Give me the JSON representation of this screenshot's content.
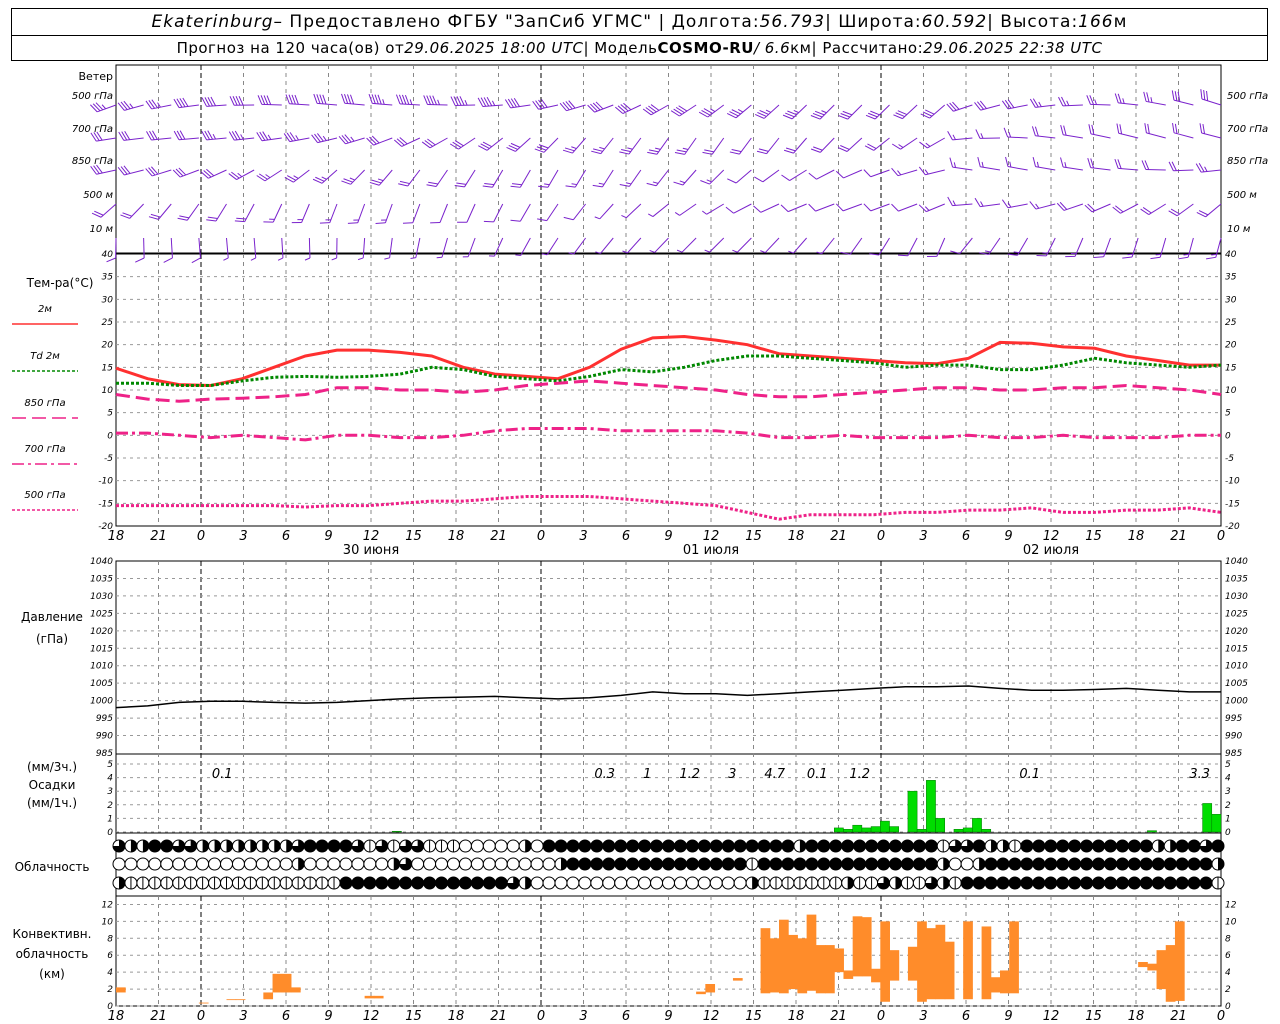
{
  "header": {
    "line1": {
      "station": "Ekaterinburg",
      "provider": " – Предоставлено ФГБУ \"ЗапСиб УГМС\" | Долгота: ",
      "lon": "56.793",
      "lat_label": " | Широта: ",
      "lat": "60.592",
      "alt_label": " | Высота: ",
      "alt": "166",
      "alt_unit": "м"
    },
    "line2": {
      "forecast_label": "Прогноз на 120 часа(ов) от ",
      "forecast_start": "29.06.2025 18:00 UTC",
      "model_label": "  | Модель ",
      "model": "COSMO-RU",
      "resolution": " / 6.6",
      "resolution_unit": "км",
      "calc_label": " | Рассчитано: ",
      "calc_time": "29.06.2025 22:38 UTC"
    }
  },
  "chart_data": {
    "time_axis": {
      "tick_labels": [
        "18",
        "21",
        "0",
        "3",
        "6",
        "9",
        "12",
        "15",
        "18",
        "21",
        "0",
        "3",
        "6",
        "9",
        "12",
        "15",
        "18",
        "21",
        "0",
        "3",
        "6",
        "9",
        "12",
        "15",
        "18",
        "21",
        "0"
      ],
      "day_labels": [
        {
          "label": "30 июня",
          "tick": 6
        },
        {
          "label": "01 июля",
          "tick": 14
        },
        {
          "label": "02 июля",
          "tick": 22
        }
      ]
    },
    "wind": {
      "title": "Ветер",
      "levels": [
        "500 гПа",
        "700 гПа",
        "850 гПа",
        "500 м",
        "10 м"
      ],
      "color": "#7a22cc"
    },
    "temperature": {
      "type": "line",
      "title": "Тем-ра(°C)",
      "ylim": [
        -20,
        40
      ],
      "yticks": [
        -20,
        -15,
        -10,
        -5,
        0,
        5,
        10,
        15,
        20,
        25,
        30,
        35,
        40
      ],
      "series": [
        {
          "name": "2м",
          "color": "#ff3030",
          "style": "solid",
          "values": [
            14.8,
            12.5,
            11.2,
            11.0,
            12.5,
            15.0,
            17.5,
            18.8,
            18.8,
            18.3,
            17.5,
            15.0,
            13.5,
            13.0,
            12.5,
            15.0,
            19.0,
            21.5,
            21.8,
            21.0,
            20.0,
            18.0,
            17.5,
            17.0,
            16.5,
            16.0,
            15.8,
            17.0,
            20.5,
            20.3,
            19.5,
            19.2,
            17.5,
            16.5,
            15.5,
            15.5
          ]
        },
        {
          "name": "Td 2м",
          "color": "#008800",
          "style": "dotted",
          "values": [
            11.5,
            11.5,
            11.0,
            11.0,
            12.0,
            12.8,
            13.0,
            12.8,
            13.0,
            13.5,
            15.0,
            14.5,
            13.0,
            12.5,
            12.0,
            13.0,
            14.5,
            14.0,
            15.0,
            16.5,
            17.5,
            17.5,
            17.0,
            16.5,
            16.0,
            15.0,
            15.5,
            15.5,
            14.5,
            14.5,
            15.5,
            17.0,
            16.0,
            15.5,
            15.0,
            15.5
          ]
        },
        {
          "name": "850 гПа",
          "color": "#ee2288",
          "style": "dashed",
          "values": [
            9.0,
            8.0,
            7.5,
            8.0,
            8.2,
            8.5,
            9.0,
            10.5,
            10.5,
            10.0,
            10.0,
            9.5,
            10.0,
            11.0,
            11.5,
            12.0,
            11.5,
            11.0,
            10.5,
            10.0,
            9.0,
            8.5,
            8.5,
            9.0,
            9.5,
            10.0,
            10.5,
            10.5,
            10.0,
            10.0,
            10.5,
            10.5,
            11.0,
            10.5,
            10.0,
            9.0
          ]
        },
        {
          "name": "700 гПа",
          "color": "#ee2288",
          "style": "dashdot",
          "values": [
            0.5,
            0.5,
            0.0,
            -0.5,
            0.0,
            -0.5,
            -1.0,
            0.0,
            0.0,
            -0.5,
            -0.5,
            0.0,
            1.0,
            1.5,
            1.5,
            1.5,
            1.0,
            1.0,
            1.0,
            1.0,
            0.5,
            -0.5,
            -0.5,
            0.0,
            -0.5,
            -0.5,
            -0.5,
            0.0,
            -0.5,
            -0.5,
            0.0,
            -0.5,
            -0.5,
            -0.5,
            0.0,
            0.0
          ]
        },
        {
          "name": "500 гПа",
          "color": "#ee2288",
          "style": "dotted",
          "values": [
            -15.5,
            -15.5,
            -15.5,
            -15.5,
            -15.5,
            -15.5,
            -15.8,
            -15.5,
            -15.5,
            -15.0,
            -14.5,
            -14.5,
            -14.0,
            -13.5,
            -13.5,
            -13.5,
            -14.0,
            -14.5,
            -15.0,
            -15.5,
            -17.0,
            -18.5,
            -17.5,
            -17.5,
            -17.5,
            -17.0,
            -17.0,
            -16.5,
            -16.5,
            -16.0,
            -17.0,
            -17.0,
            -16.5,
            -16.5,
            -16.0,
            -17.0
          ]
        }
      ]
    },
    "pressure": {
      "type": "line",
      "title": "Давление",
      "unit": "(гПа)",
      "ylim": [
        985,
        1040
      ],
      "yticks": [
        985,
        990,
        995,
        1000,
        1005,
        1010,
        1015,
        1020,
        1025,
        1030,
        1035,
        1040
      ],
      "values": [
        998.0,
        998.5,
        999.5,
        999.8,
        999.8,
        999.5,
        999.3,
        999.5,
        1000.0,
        1000.5,
        1000.8,
        1001.0,
        1001.2,
        1000.8,
        1000.5,
        1000.8,
        1001.5,
        1002.5,
        1002.0,
        1002.0,
        1001.5,
        1002.0,
        1002.5,
        1003.0,
        1003.5,
        1004.0,
        1004.0,
        1004.2,
        1003.5,
        1003.0,
        1003.0,
        1003.2,
        1003.5,
        1003.0,
        1002.5,
        1002.5
      ]
    },
    "precipitation": {
      "type": "bar",
      "title": "(мм/3ч.)",
      "subtitle": "Осадки",
      "unit": "(мм/1ч.)",
      "ylim": [
        0,
        5
      ],
      "yticks": [
        0,
        1,
        2,
        3,
        4,
        5
      ],
      "color": "#00dd00",
      "totals_3h": [
        {
          "tick": 2.5,
          "label": "0.1"
        },
        {
          "tick": 11.5,
          "label": "0.3"
        },
        {
          "tick": 12.5,
          "label": "1"
        },
        {
          "tick": 13.5,
          "label": "1.2"
        },
        {
          "tick": 14.5,
          "label": "3"
        },
        {
          "tick": 15.5,
          "label": "4.7"
        },
        {
          "tick": 16.5,
          "label": "0.1"
        },
        {
          "tick": 17.5,
          "label": "1.2"
        },
        {
          "tick": 21.5,
          "label": "0.1"
        },
        {
          "tick": 25.5,
          "label": "3.3"
        }
      ],
      "hourly": [
        {
          "h": 30,
          "v": 0.05
        },
        {
          "h": 78,
          "v": 0.3
        },
        {
          "h": 79,
          "v": 0.2
        },
        {
          "h": 80,
          "v": 0.5
        },
        {
          "h": 81,
          "v": 0.3
        },
        {
          "h": 82,
          "v": 0.4
        },
        {
          "h": 83,
          "v": 0.8
        },
        {
          "h": 84,
          "v": 0.4
        },
        {
          "h": 86,
          "v": 3.0
        },
        {
          "h": 87,
          "v": 0.2
        },
        {
          "h": 88,
          "v": 3.8
        },
        {
          "h": 89,
          "v": 1.0
        },
        {
          "h": 91,
          "v": 0.2
        },
        {
          "h": 92,
          "v": 0.3
        },
        {
          "h": 93,
          "v": 1.0
        },
        {
          "h": 94,
          "v": 0.2
        },
        {
          "h": 112,
          "v": 0.1
        },
        {
          "h": 118,
          "v": 2.1
        },
        {
          "h": 119,
          "v": 1.3
        }
      ]
    },
    "cloudiness": {
      "title": "Облачность",
      "rows": [
        [
          3,
          2,
          2,
          4,
          4,
          3,
          3,
          2,
          2,
          2,
          2,
          2,
          2,
          2,
          2,
          3,
          4,
          4,
          4,
          4,
          3,
          1,
          3,
          1,
          3,
          3,
          1,
          1,
          1,
          0,
          0,
          0,
          0,
          0,
          2,
          0,
          4,
          4,
          4,
          4,
          4,
          4,
          4,
          4,
          4,
          4,
          4,
          4,
          4,
          4,
          4,
          4,
          4,
          4,
          4,
          4,
          4,
          2,
          4,
          4,
          4,
          4,
          4,
          4,
          4,
          4,
          4,
          4,
          4,
          1,
          3,
          3,
          4,
          2,
          2,
          1,
          4,
          4,
          4,
          4,
          4,
          4,
          4,
          4,
          4,
          4,
          4,
          2,
          2,
          4,
          4,
          3,
          4
        ],
        [
          0,
          0,
          0,
          0,
          0,
          0,
          0,
          0,
          0,
          0,
          0,
          0,
          0,
          0,
          0,
          2,
          0,
          0,
          0,
          0,
          0,
          0,
          0,
          2,
          3,
          0,
          0,
          0,
          0,
          0,
          0,
          0,
          0,
          0,
          0,
          0,
          0,
          2,
          4,
          4,
          4,
          4,
          4,
          4,
          4,
          4,
          4,
          4,
          4,
          4,
          4,
          4,
          4,
          1,
          4,
          4,
          4,
          4,
          4,
          4,
          4,
          4,
          4,
          4,
          4,
          4,
          4,
          4,
          4,
          2,
          0,
          0,
          2,
          4,
          4,
          4,
          4,
          4,
          4,
          4,
          4,
          4,
          4,
          4,
          4,
          4,
          4,
          4,
          4,
          4,
          4,
          4,
          2
        ],
        [
          2,
          1,
          1,
          1,
          1,
          1,
          1,
          1,
          1,
          1,
          1,
          1,
          1,
          1,
          1,
          1,
          1,
          1,
          1,
          4,
          4,
          4,
          4,
          4,
          4,
          4,
          4,
          4,
          4,
          4,
          4,
          4,
          4,
          3,
          2,
          0,
          0,
          0,
          0,
          0,
          0,
          0,
          0,
          0,
          0,
          0,
          0,
          0,
          0,
          0,
          0,
          0,
          0,
          2,
          1,
          1,
          1,
          1,
          1,
          1,
          1,
          2,
          1,
          1,
          3,
          2,
          1,
          1,
          3,
          2,
          1,
          4,
          4,
          4,
          4,
          4,
          4,
          4,
          4,
          4,
          4,
          4,
          4,
          4,
          4,
          4,
          4,
          4,
          4,
          4,
          4,
          4,
          1
        ]
      ]
    },
    "convective": {
      "type": "bar",
      "title": "Конвективн.",
      "subtitle": "облачность",
      "unit": "(км)",
      "ylim": [
        0,
        13
      ],
      "yticks": [
        0,
        2,
        4,
        6,
        8,
        10,
        12
      ],
      "color": "#ff8c2a",
      "bars": [
        {
          "h": 0,
          "base": 1.6,
          "top": 2.2
        },
        {
          "h": 9,
          "base": 0.3,
          "top": 0.4
        },
        {
          "h": 12,
          "base": 0.7,
          "top": 0.8
        },
        {
          "h": 13,
          "base": 0.7,
          "top": 0.8
        },
        {
          "h": 16,
          "base": 0.8,
          "top": 1.6
        },
        {
          "h": 17,
          "base": 1.6,
          "top": 3.8
        },
        {
          "h": 18,
          "base": 1.6,
          "top": 3.8
        },
        {
          "h": 19,
          "base": 1.6,
          "top": 2.2
        },
        {
          "h": 27,
          "base": 0.9,
          "top": 1.2
        },
        {
          "h": 28,
          "base": 0.9,
          "top": 1.2
        },
        {
          "h": 63,
          "base": 1.4,
          "top": 1.7
        },
        {
          "h": 64,
          "base": 1.6,
          "top": 2.6
        },
        {
          "h": 67,
          "base": 3.0,
          "top": 3.3
        },
        {
          "h": 70,
          "base": 1.5,
          "top": 9.2
        },
        {
          "h": 71,
          "base": 1.6,
          "top": 8.0
        },
        {
          "h": 72,
          "base": 1.5,
          "top": 10.2
        },
        {
          "h": 73,
          "base": 2.0,
          "top": 8.4
        },
        {
          "h": 74,
          "base": 1.5,
          "top": 8.0
        },
        {
          "h": 75,
          "base": 1.8,
          "top": 10.8
        },
        {
          "h": 76,
          "base": 1.5,
          "top": 7.2
        },
        {
          "h": 77,
          "base": 1.5,
          "top": 7.2
        },
        {
          "h": 78,
          "base": 4.0,
          "top": 6.8
        },
        {
          "h": 79,
          "base": 3.2,
          "top": 4.2
        },
        {
          "h": 80,
          "base": 3.5,
          "top": 10.6
        },
        {
          "h": 81,
          "base": 3.5,
          "top": 10.5
        },
        {
          "h": 82,
          "base": 2.8,
          "top": 4.4
        },
        {
          "h": 83,
          "base": 0.5,
          "top": 10.0
        },
        {
          "h": 84,
          "base": 3.0,
          "top": 6.6
        },
        {
          "h": 86,
          "base": 3.0,
          "top": 7.0
        },
        {
          "h": 87,
          "base": 0.5,
          "top": 10.0
        },
        {
          "h": 88,
          "base": 0.8,
          "top": 9.2
        },
        {
          "h": 89,
          "base": 0.8,
          "top": 9.6
        },
        {
          "h": 90,
          "base": 0.8,
          "top": 7.6
        },
        {
          "h": 92,
          "base": 0.8,
          "top": 10.0
        },
        {
          "h": 94,
          "base": 0.8,
          "top": 9.4
        },
        {
          "h": 95,
          "base": 1.6,
          "top": 3.4
        },
        {
          "h": 96,
          "base": 1.5,
          "top": 4.2
        },
        {
          "h": 97,
          "base": 1.5,
          "top": 10.0
        },
        {
          "h": 111,
          "base": 4.6,
          "top": 5.2
        },
        {
          "h": 112,
          "base": 4.2,
          "top": 5.0
        },
        {
          "h": 113,
          "base": 2.0,
          "top": 6.6
        },
        {
          "h": 114,
          "base": 0.5,
          "top": 7.2
        },
        {
          "h": 115,
          "base": 0.6,
          "top": 10.0
        }
      ]
    }
  }
}
